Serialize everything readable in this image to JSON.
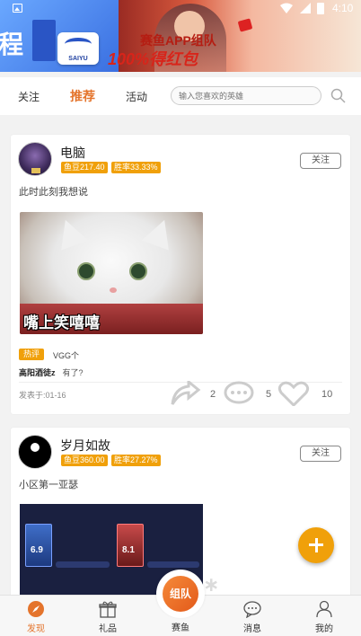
{
  "status_bar": {
    "time": "4:10"
  },
  "banner": {
    "left_char": "程",
    "logo_text": "SAIYU",
    "promo_line1": "赛鱼APP组队",
    "promo_line2": "100%得红包"
  },
  "tabs": {
    "items": [
      {
        "label": "关注",
        "active": false
      },
      {
        "label": "推荐",
        "active": true
      },
      {
        "label": "活动",
        "active": false
      }
    ],
    "search_placeholder": "输入您喜欢的英雄"
  },
  "posts": [
    {
      "username": "电脑",
      "tags": [
        "鱼豆217.40",
        "胜率33.33%"
      ],
      "follow_label": "关注",
      "text": "此时此刻我想说",
      "image_caption": "嘴上笑嘻嘻",
      "hot_tag": "热评",
      "hot_text": "VGG个",
      "comment_user": "高阳酒徒z",
      "comment_text": "有了?",
      "time": "发表于:01-16",
      "shares": "2",
      "comments": "5",
      "likes": "10"
    },
    {
      "username": "岁月如故",
      "tags": [
        "鱼豆360.00",
        "胜率27.27%"
      ],
      "follow_label": "关注",
      "text": "小区第一亚瑟",
      "game_scores": [
        "6.9",
        "8.1"
      ]
    }
  ],
  "bottom_nav": {
    "items": [
      {
        "label": "发现",
        "icon": "compass-icon",
        "active": true
      },
      {
        "label": "礼品",
        "icon": "gift-icon",
        "active": false
      },
      {
        "label": "赛鱼",
        "icon": "team-icon",
        "active": false
      },
      {
        "label": "消息",
        "icon": "message-icon",
        "active": false
      },
      {
        "label": "我的",
        "icon": "profile-icon",
        "active": false
      }
    ],
    "center_button_text": "组队"
  },
  "colors": {
    "accent": "#e4742c",
    "tag": "#f0a00a"
  }
}
